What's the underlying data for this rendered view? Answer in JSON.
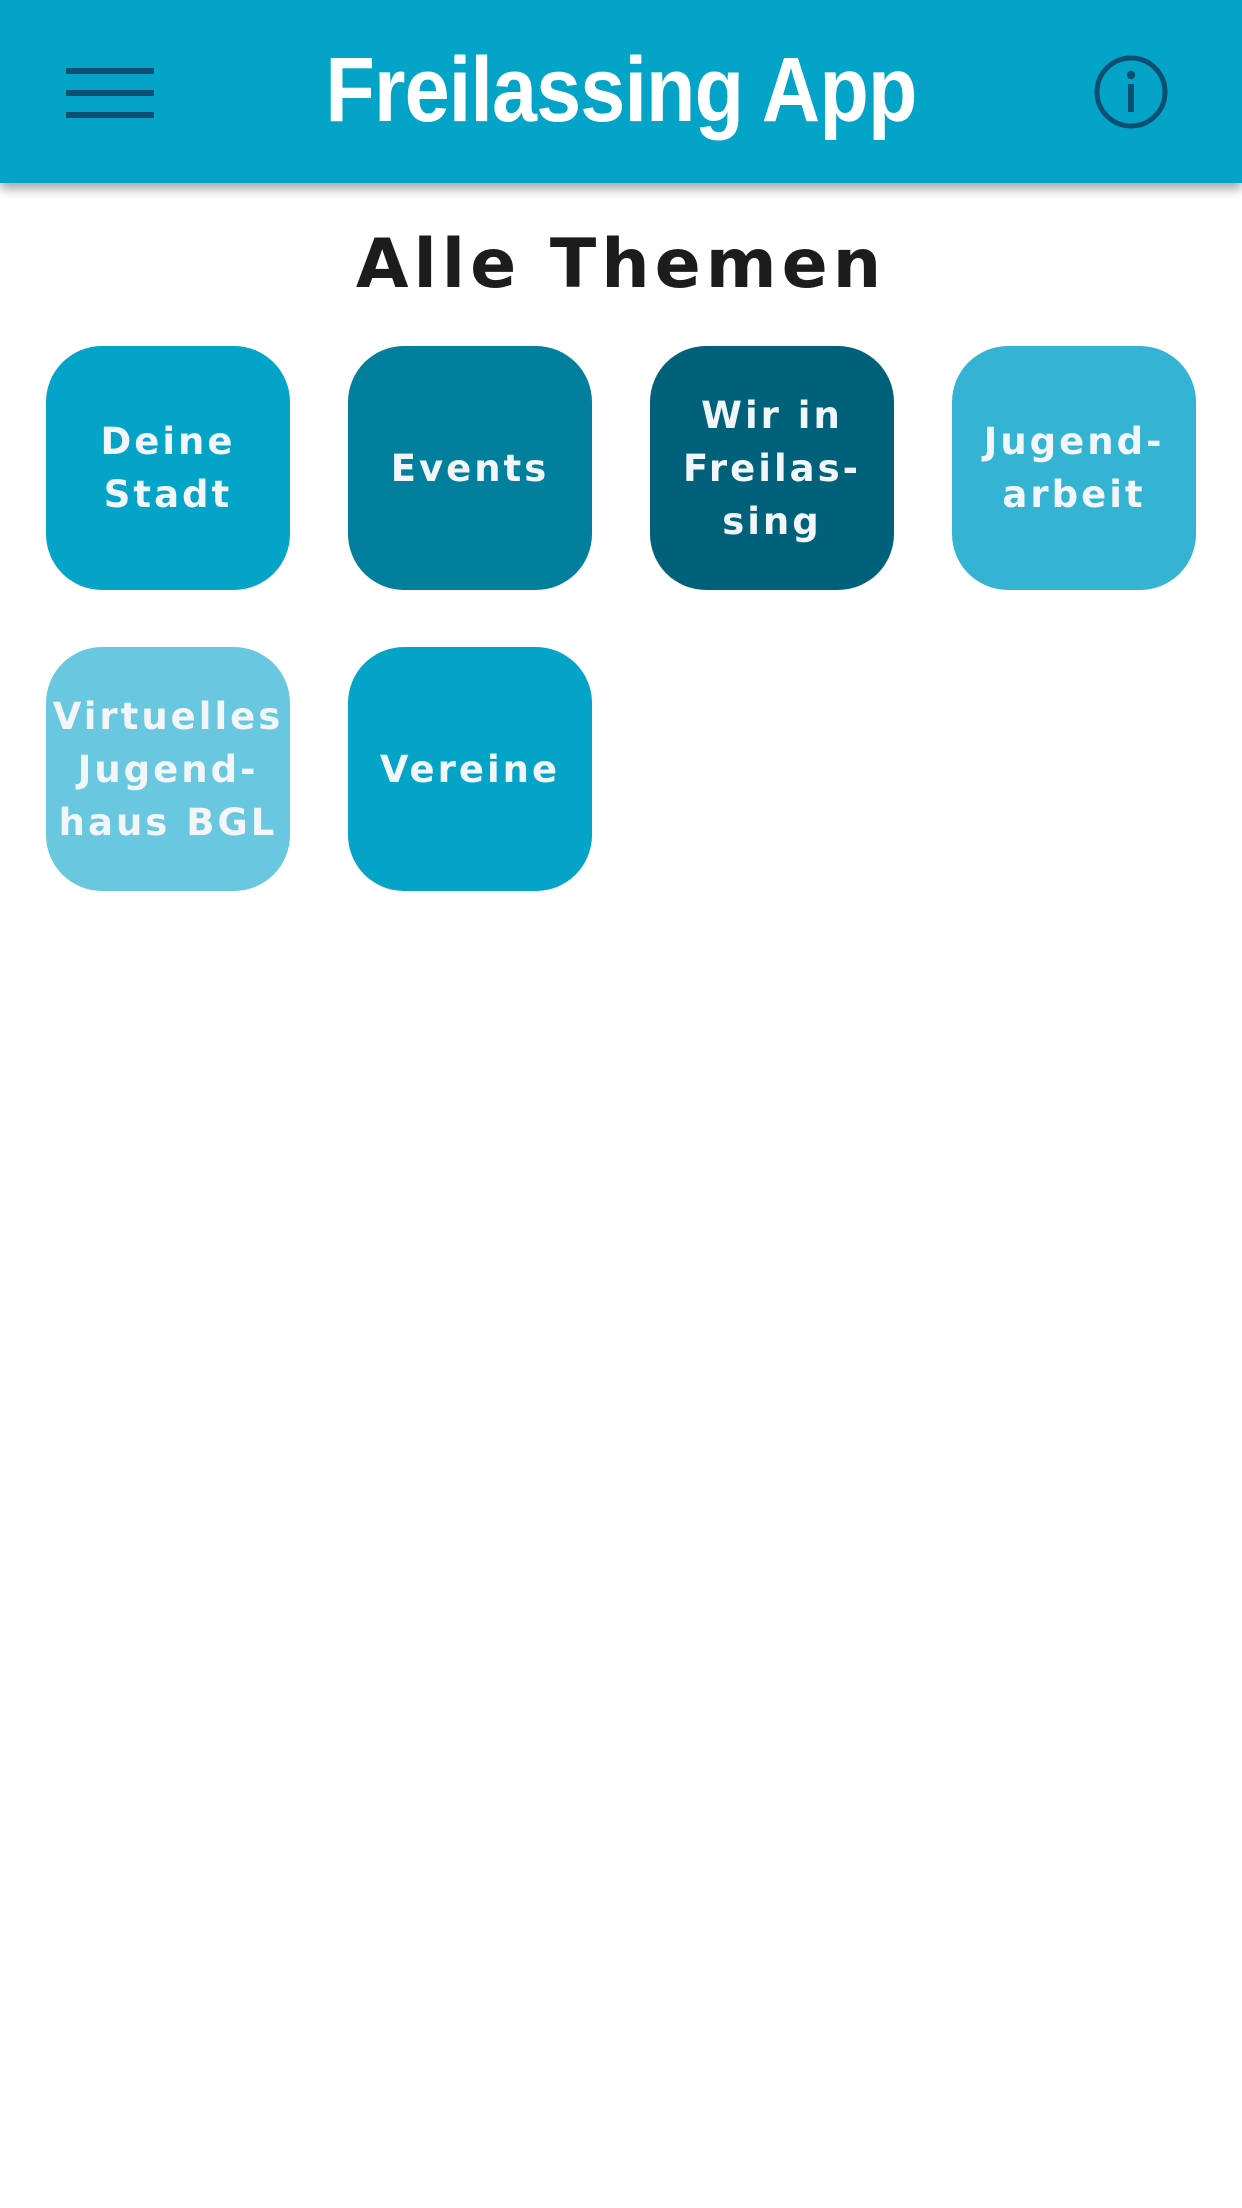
{
  "app_bar": {
    "title": "Freilassing App",
    "menu_icon": "hamburger-menu-icon",
    "info_icon": "info-circle-icon",
    "background_color": "#03a4c8",
    "icon_color": "#0d4f72"
  },
  "main": {
    "section_title": "Alle Themen",
    "topics": [
      {
        "label": "Deine\nStadt",
        "color": "#03a4c8"
      },
      {
        "label": "Events",
        "color": "#017f9c"
      },
      {
        "label": "Wir in\nFreilas-\nsing",
        "color": "#02617a"
      },
      {
        "label": "Jugend-\narbeit",
        "color": "#35b3d3"
      },
      {
        "label": "Virtuelles\nJugend-\nhaus BGL",
        "color": "#69c7df"
      },
      {
        "label": "Vereine",
        "color": "#03a4c8"
      }
    ]
  }
}
